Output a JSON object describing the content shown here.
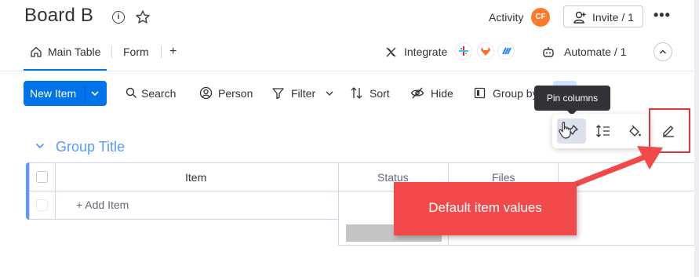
{
  "board": {
    "title": "Board B"
  },
  "header": {
    "activity_label": "Activity",
    "avatar_initials": "CF",
    "avatar_color": "#fd7a2b",
    "invite_label": "Invite / 1"
  },
  "tabs": [
    {
      "label": "Main Table",
      "active": true
    },
    {
      "label": "Form",
      "active": false
    }
  ],
  "add_tab_label": "+",
  "integrate_label": "Integrate",
  "automate_label": "Automate / 1",
  "toolbar": {
    "new_item_label": "New Item",
    "search_label": "Search",
    "person_label": "Person",
    "filter_label": "Filter",
    "sort_label": "Sort",
    "hide_label": "Hide",
    "group_by_label": "Group by"
  },
  "tooltip": {
    "text": "Pin columns"
  },
  "group": {
    "title": "Group Title",
    "color": "#579bfc"
  },
  "table": {
    "columns": [
      "Item",
      "Status",
      "Files"
    ],
    "add_item_label": "+ Add Item"
  },
  "callout": {
    "text": "Default item values",
    "color": "#f24a4a"
  },
  "colors": {
    "accent": "#0073ea",
    "highlight_box": "#e0353a"
  }
}
